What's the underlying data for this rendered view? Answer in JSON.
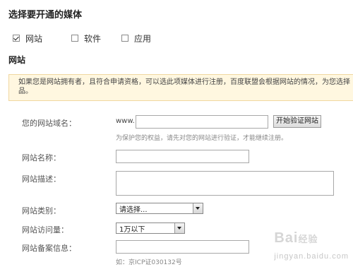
{
  "page": {
    "title": "选择要开通的媒体"
  },
  "media_options": [
    {
      "label": "网站",
      "checked": true
    },
    {
      "label": "软件",
      "checked": false
    },
    {
      "label": "应用",
      "checked": false
    }
  ],
  "section": {
    "title": "网站"
  },
  "notice": {
    "line1": "如果您是网站拥有者，且符合申请资格，可以选此项媒体进行注册，百度联盟会根据网站的情况，为您选择",
    "line2": "品。"
  },
  "form": {
    "domain": {
      "label": "您的网站域名：",
      "prefix": "www.",
      "value": "",
      "verify_button": "开始验证网站",
      "hint": "为保护您的权益，请先对您的网站进行验证，才能继续注册。"
    },
    "site_name": {
      "label": "网站名称：",
      "value": ""
    },
    "site_desc": {
      "label": "网站描述：",
      "value": ""
    },
    "site_category": {
      "label": "网站类别：",
      "selected": "请选择..."
    },
    "site_traffic": {
      "label": "网站访问量：",
      "selected": "1万以下"
    },
    "site_icp": {
      "label": "网站备案信息：",
      "value": "",
      "hint": "如：京ICP证030132号"
    }
  },
  "watermark": {
    "text": "Bai",
    "text2": "经验",
    "sub": "jingyan.baidu.com"
  }
}
